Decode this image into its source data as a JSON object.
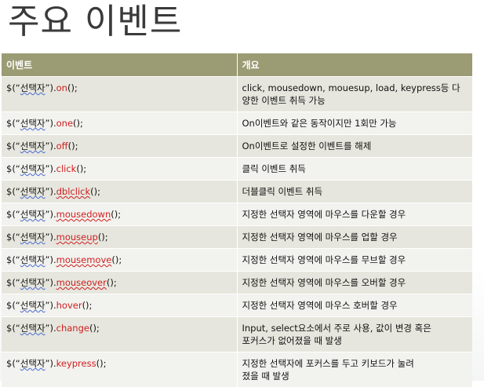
{
  "title": "주요 이벤트",
  "table": {
    "headers": [
      "이벤트",
      "개요"
    ],
    "rows": [
      {
        "prefix": "$(“",
        "selector": "선택자",
        "mid": "”).",
        "method": "on",
        "method_underline": false,
        "suffix": "();",
        "desc": [
          "click, mousedown, mouesup, load, keypress등 다",
          "양한 이벤트 취득 가능"
        ]
      },
      {
        "prefix": "$(“",
        "selector": "선택자",
        "mid": "”).",
        "method": "one",
        "method_underline": false,
        "suffix": "();",
        "desc": [
          "On이벤트와 같은 동작이지만 1회만 가능"
        ]
      },
      {
        "prefix": "$(“",
        "selector": "선택자",
        "mid": "”).",
        "method": "off",
        "method_underline": false,
        "suffix": "();",
        "desc": [
          "On이벤트로 설정한 이벤트를 해제"
        ]
      },
      {
        "prefix": "$(“",
        "selector": "선택자",
        "mid": "”).",
        "method": "click",
        "method_underline": false,
        "suffix": "();",
        "desc": [
          "클릭 이벤트 취득"
        ]
      },
      {
        "prefix": "$(“",
        "selector": "선택자",
        "mid": "”).",
        "method": "dblclick",
        "method_underline": true,
        "suffix": "();",
        "desc": [
          "더블클릭 이벤트 취득"
        ]
      },
      {
        "prefix": "$(“",
        "selector": "선택자",
        "mid": "”).",
        "method": "mousedown",
        "method_underline": true,
        "suffix": "();",
        "desc": [
          "지정한 선택자 영역에 마우스를 다운할 경우"
        ]
      },
      {
        "prefix": "$(“",
        "selector": "선택자",
        "mid": "”).",
        "method": "mouseup",
        "method_underline": true,
        "suffix": "();",
        "desc": [
          "지정한 선택자 영역에 마우스를 업할 경우"
        ]
      },
      {
        "prefix": "$(“",
        "selector": "선택자",
        "mid": "”).",
        "method": "mousemove",
        "method_underline": true,
        "suffix": "();",
        "desc": [
          "지정한 선택자 영역에 마우스를 무브할 경우"
        ]
      },
      {
        "prefix": "$(“",
        "selector": "선택자",
        "mid": "”).",
        "method": "mouseover",
        "method_underline": true,
        "suffix": "();",
        "desc": [
          "지정한 선택자 영역에 마우스를 오버할 경우"
        ]
      },
      {
        "prefix": "$(“",
        "selector": "선택자",
        "mid": "”).",
        "method": "hover",
        "method_underline": false,
        "suffix": "();",
        "desc": [
          "지정한 선택자 영역에 마우스 호버할 경우"
        ]
      },
      {
        "prefix": "$(“",
        "selector": "선택자",
        "mid": "”).",
        "method": "change",
        "method_underline": false,
        "suffix": "();",
        "desc": [
          "Input, select요소에서 주로 사용, 값이 변경 혹은",
          "포커스가 없어졌을 때 발생"
        ]
      },
      {
        "prefix": "$(“",
        "selector": "선택자",
        "mid": "”).",
        "method": "keypress",
        "method_underline": false,
        "suffix": "();",
        "desc": [
          "지정한 선택자에 포커스를 두고 키보드가 눌려",
          "졌을 때 발생"
        ]
      }
    ]
  },
  "colors": {
    "header_bg": "#9b9b74",
    "row_odd": "#e6e6de",
    "row_even": "#f2f2ee",
    "method_color": "#d01e1e"
  }
}
